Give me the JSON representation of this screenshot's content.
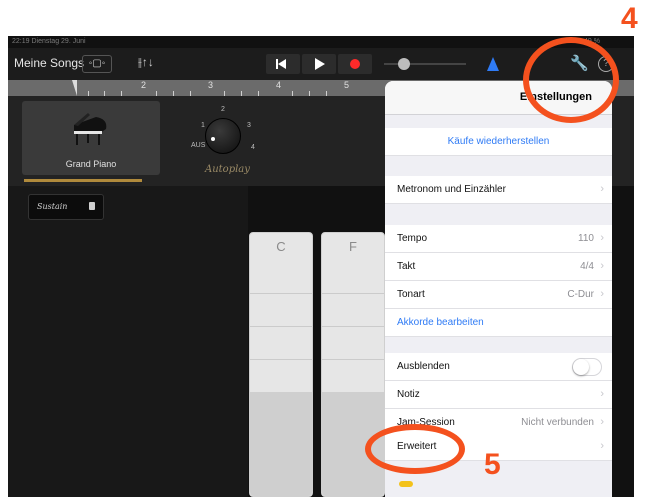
{
  "statusbar": {
    "time": "22:19  Dienstag 29. Juni",
    "battery": "49 %"
  },
  "toolbar": {
    "songs_label": "Meine Songs",
    "view_glyph": "◦▢◦",
    "mixer_glyph": "⫲↑↓",
    "wrench_glyph": "🔧",
    "help_glyph": "?"
  },
  "ruler": {
    "marks": [
      "2",
      "3",
      "4",
      "5"
    ]
  },
  "instrument": {
    "name": "Grand Piano"
  },
  "autoplay": {
    "label": "Autoplay",
    "positions": [
      "AUS",
      "1",
      "2",
      "3",
      "4"
    ]
  },
  "sustain": {
    "label": "Sustain"
  },
  "chords": [
    {
      "label": "C"
    },
    {
      "label": "F"
    }
  ],
  "settings": {
    "title": "Einstellungen",
    "restore_purchases": "Käufe wiederherstellen",
    "metronome": "Metronom und Einzähler",
    "tempo": {
      "label": "Tempo",
      "value": "110"
    },
    "takt": {
      "label": "Takt",
      "value": "4/4"
    },
    "tonart": {
      "label": "Tonart",
      "value": "C-Dur"
    },
    "edit_chords": "Akkorde bearbeiten",
    "fade_out": {
      "label": "Ausblenden",
      "on": false
    },
    "note": "Notiz",
    "jam": {
      "label": "Jam-Session",
      "value": "Nicht verbunden"
    },
    "advanced": "Erweitert",
    "chevron": "›"
  },
  "annotations": {
    "step4": "4",
    "step5": "5"
  },
  "colors": {
    "accent": "#2f7bf5",
    "annotation": "#f4511e",
    "record": "#ff2a2a"
  }
}
